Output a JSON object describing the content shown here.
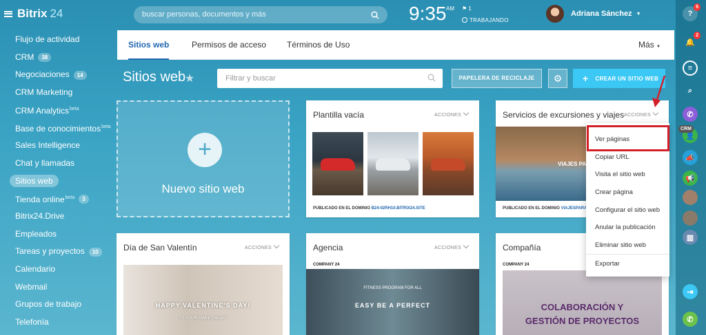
{
  "brand": {
    "part1": "Bitrix",
    "part2": "24"
  },
  "sidebar": {
    "items": [
      {
        "label": "Flujo de actividad"
      },
      {
        "label": "CRM",
        "count": "38"
      },
      {
        "label": "Negociaciones",
        "count": "14"
      },
      {
        "label": "CRM Marketing"
      },
      {
        "label": "CRM Analytics",
        "sup": "beta"
      },
      {
        "label": "Base de conocimientos",
        "sup": "beta"
      },
      {
        "label": "Sales Intelligence"
      },
      {
        "label": "Chat y llamadas"
      },
      {
        "label": "Sitios web",
        "active": true
      },
      {
        "label": "Tienda online",
        "sup": "beta",
        "count": "3"
      },
      {
        "label": "Bitrix24.Drive"
      },
      {
        "label": "Empleados"
      },
      {
        "label": "Tareas y proyectos",
        "count": "10"
      },
      {
        "label": "Calendario"
      },
      {
        "label": "Webmail"
      },
      {
        "label": "Grupos de trabajo"
      },
      {
        "label": "Telefonía"
      }
    ]
  },
  "header": {
    "search_placeholder": "buscar personas, documentos y más",
    "time": "9:35",
    "ampm": "AM",
    "flag_count": "1",
    "status": "TRABAJANDO",
    "user_name": "Adriana Sánchez"
  },
  "rightbar": {
    "help_badge": "5",
    "notif_badge": "2",
    "crm_label": "CRM"
  },
  "tabs": [
    {
      "label": "Sitios web",
      "active": true
    },
    {
      "label": "Permisos de acceso"
    },
    {
      "label": "Términos de Uso"
    }
  ],
  "more_label": "Más",
  "page": {
    "title": "Sitios web",
    "filter_placeholder": "Filtrar y buscar",
    "trash_button": "PAPELERA DE RECICLAJE",
    "create_button": "CREAR UN SITIO WEB",
    "new_site": "Nuevo sitio web"
  },
  "cards": {
    "actions_label": "ACCIONES",
    "domain_prefix": "PUBLICADO EN EL DOMINIO",
    "c1": {
      "title": "Plantilla vacía",
      "domain": "B24-02RH10.BITRIX24.SITE"
    },
    "c2": {
      "title": "Servicios de excursiones y viajes",
      "domain": "VIAJESPARATOD",
      "hero_text": "VIAJES PARA"
    },
    "c3": {
      "title": "Día de San Valentín",
      "banner": "HAPPY VALENTINE'S DAY!",
      "sub": "TO YOUR SWEETHEART"
    },
    "c4": {
      "title": "Agencia",
      "company": "COMPANY 24",
      "hero": "EASY BE A PERFECT",
      "small": "FITNESS PROGRAM FOR ALL"
    },
    "c5": {
      "title": "Compañía",
      "company": "COMPANY 24",
      "hero_line1": "COLABORACIÓN Y",
      "hero_line2": "GESTIÓN DE PROYECTOS"
    }
  },
  "dropdown": {
    "items": [
      "Ver páginas",
      "Copiar URL",
      "Visita el sitio web",
      "Crear página",
      "Configurar el sitio web",
      "Anular la publicación",
      "Eliminar sitio web"
    ],
    "export": "Exportar"
  },
  "colors": {
    "accent": "#3bc8f5",
    "tab_active": "#2067b0",
    "highlight": "#d41f29"
  }
}
